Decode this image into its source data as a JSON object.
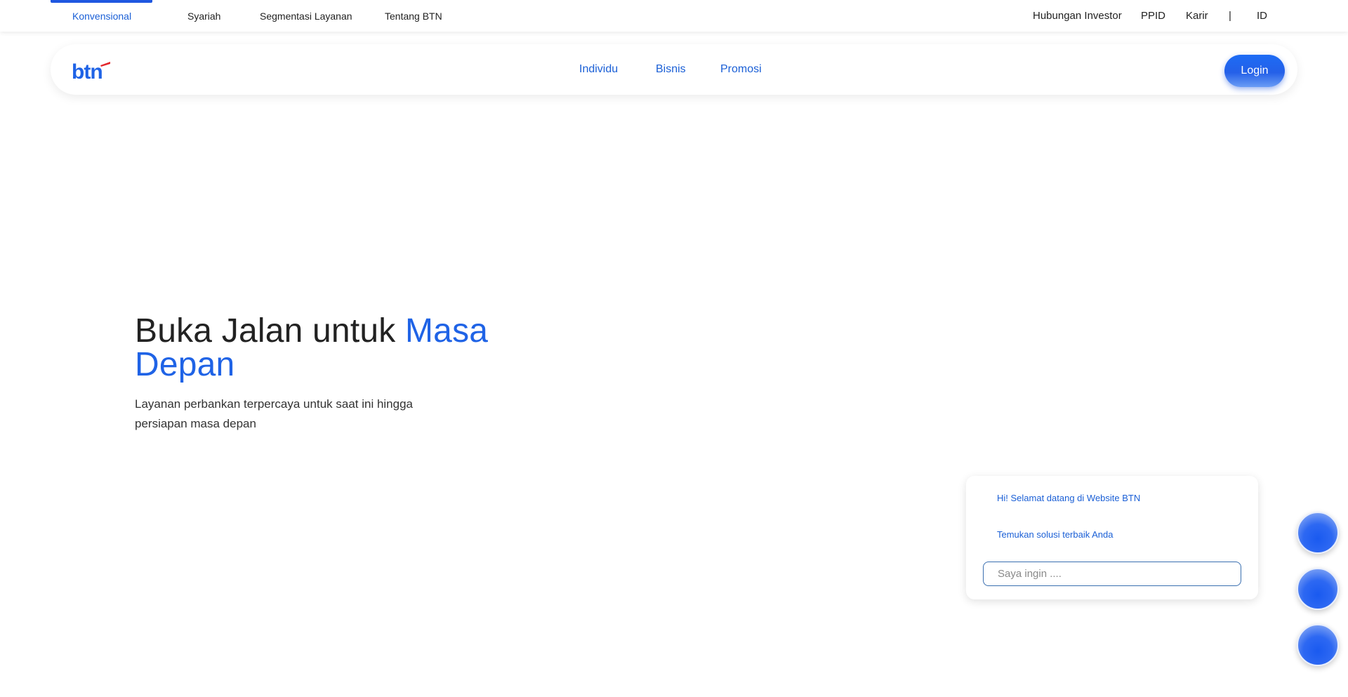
{
  "topbar": {
    "segments": [
      "Konvensional",
      "Syariah",
      "Segmentasi Layanan",
      "Tentang BTN"
    ],
    "right_links": [
      "Hubungan Investor",
      "PPID",
      "Karir"
    ],
    "separator": "|",
    "language": "ID"
  },
  "nav": {
    "logo_text": "btn",
    "links": [
      "Individu",
      "Bisnis",
      "Promosi"
    ],
    "login_label": "Login"
  },
  "hero": {
    "title_part1": "Buka Jalan untuk ",
    "title_accent": "Masa Depan",
    "subtitle": "Layanan perbankan terpercaya untuk saat ini hingga persiapan masa depan"
  },
  "chat": {
    "greeting": "Hi! Selamat datang di Website BTN",
    "prompt": "Temukan solusi terbaik Anda",
    "input_placeholder": "Saya ingin ...."
  },
  "colors": {
    "brand_blue": "#1f63e6",
    "link_blue": "#1a5fd6",
    "logo_red": "#e3262b"
  }
}
